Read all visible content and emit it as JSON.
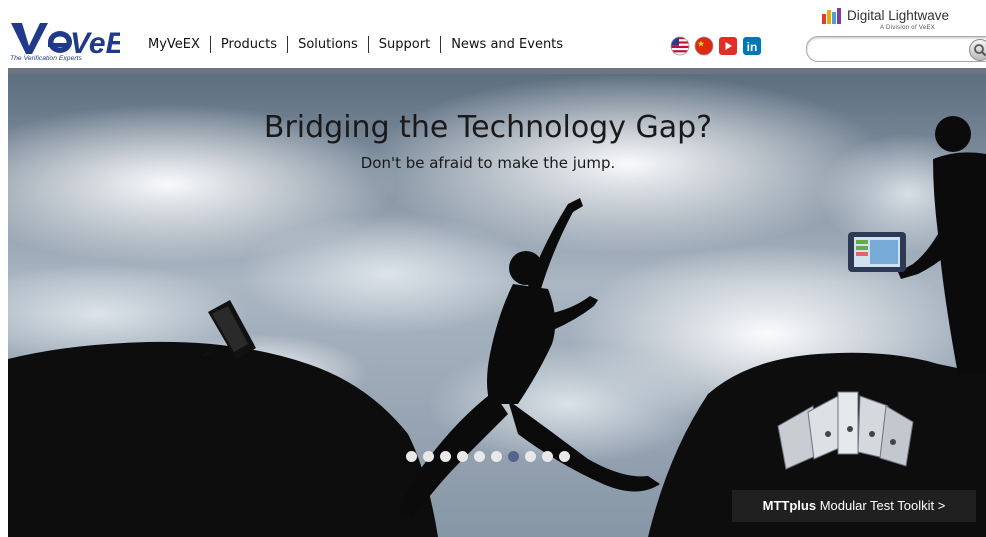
{
  "header": {
    "logo_text": "VeEX",
    "logo_tagline": "The Verification Experts",
    "nav": [
      "MyVeEX",
      "Products",
      "Solutions",
      "Support",
      "News and Events"
    ],
    "social_icons": [
      "us-flag-icon",
      "china-flag-icon",
      "youtube-icon",
      "linkedin-icon"
    ],
    "brand_title": "Digital Lightwave",
    "brand_sub": "A Division of VeEX",
    "search_value": "",
    "brand_color": "#1f3a8a",
    "nav_bar_color": "#6b7682"
  },
  "hero": {
    "headline": "Bridging the Technology Gap?",
    "subline": "Don't be afraid to make the jump.",
    "slides_total": 10,
    "active_slide": 7,
    "promo_bold": "MTTplus",
    "promo_rest": " Modular Test Toolkit >"
  }
}
